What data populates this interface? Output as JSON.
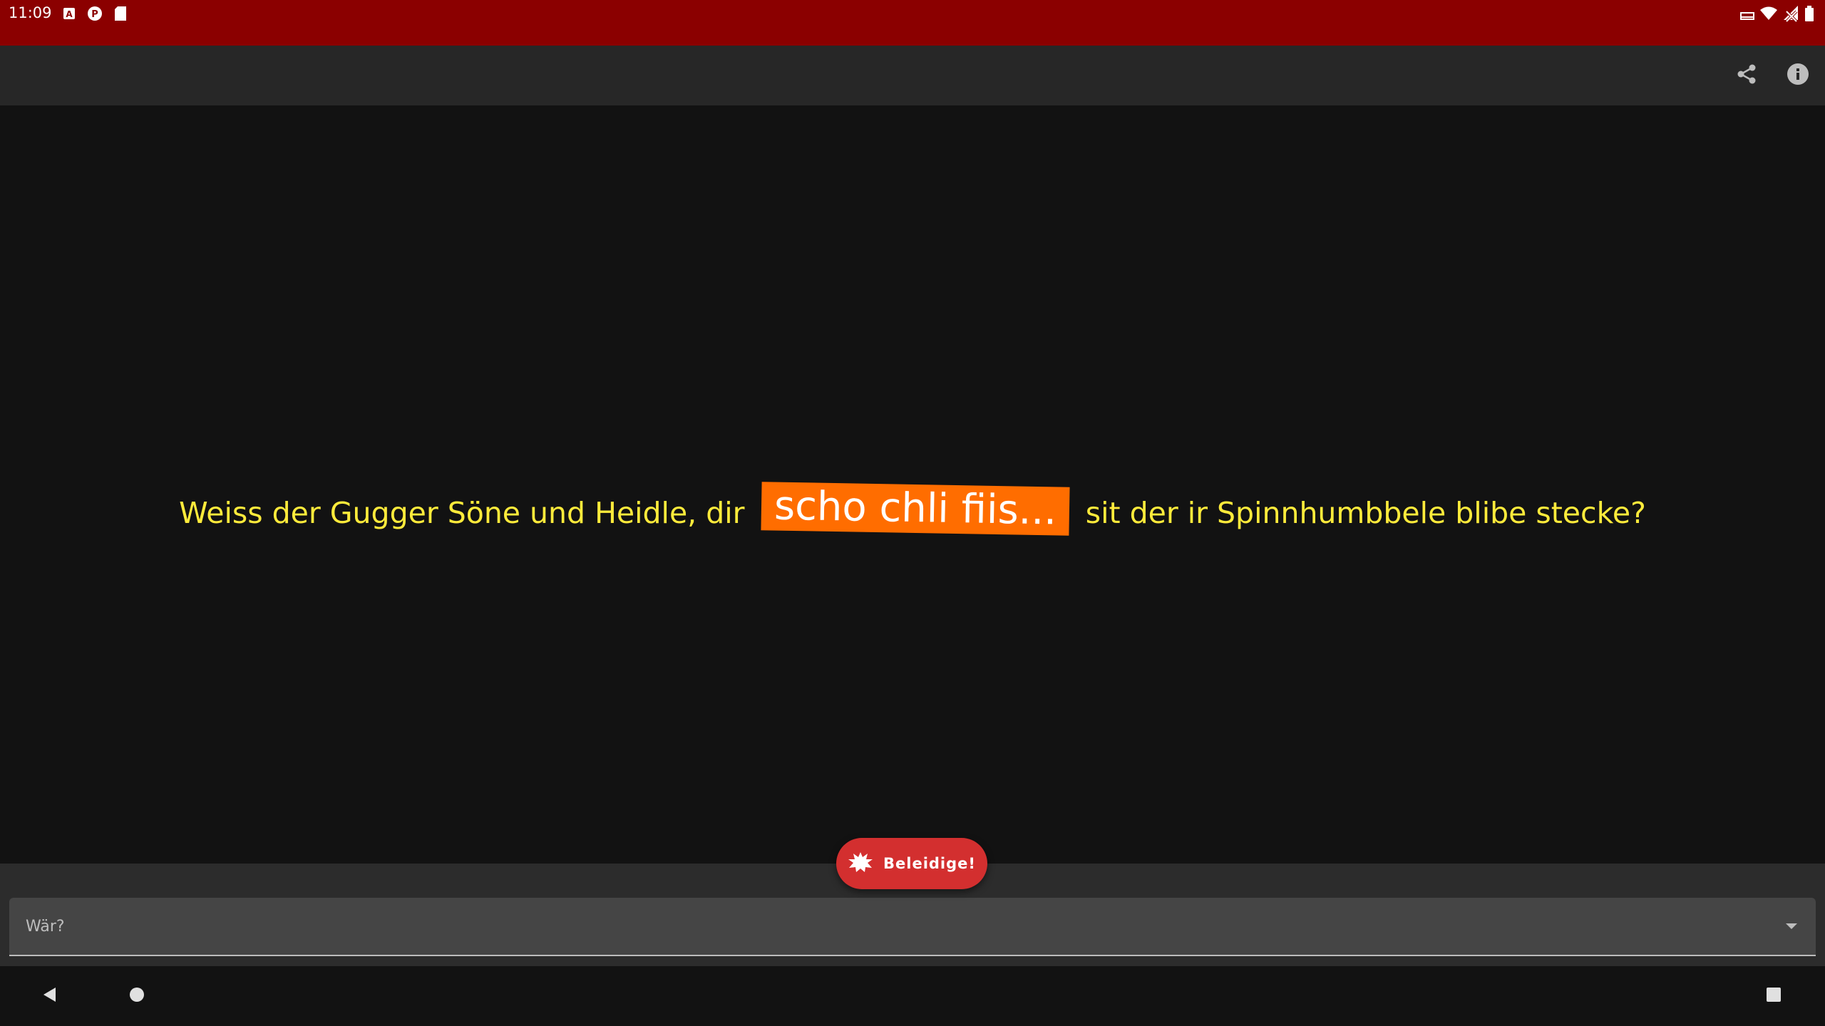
{
  "status_bar": {
    "time": "11:09",
    "background": "#8b0000",
    "left_icons": [
      "a-notification-icon",
      "p-notification-icon",
      "sd-card-icon"
    ],
    "right_icons": [
      "cast-icon",
      "wifi-icon",
      "cellular-off-icon",
      "battery-icon"
    ]
  },
  "app_bar": {
    "background": "#272727",
    "actions": [
      "share-icon",
      "info-icon"
    ]
  },
  "insult": {
    "before": "Weiss der Gugger Söne und Heidle, dir",
    "highlight": "scho chli fiis...",
    "after": "sit der ir Spinnhumbbele blibe stecke?",
    "text_color": "#ffeb3b",
    "highlight_color": "#ff6d00"
  },
  "fab": {
    "label": "Beleidige!",
    "icon": "explosion-icon",
    "color": "#d32f2f"
  },
  "recipient_select": {
    "placeholder": "Wär?",
    "icon": "dropdown-arrow-icon"
  },
  "nav_bar": {
    "buttons": [
      "back-icon",
      "home-icon",
      "recents-icon"
    ]
  }
}
